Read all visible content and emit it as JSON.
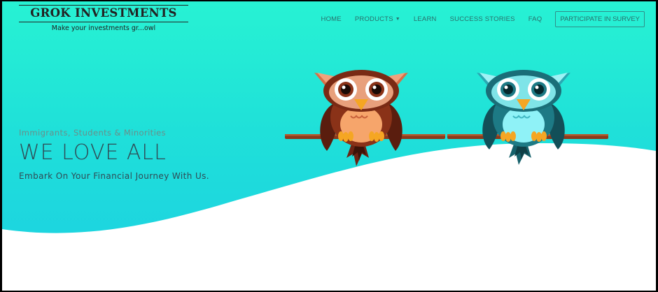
{
  "brand": {
    "name": "GROK INVESTMENTS",
    "tagline": "Make your investments gr...owl"
  },
  "nav": {
    "items": [
      {
        "label": "HOME"
      },
      {
        "label": "PRODUCTS",
        "has_dropdown": true
      },
      {
        "label": "LEARN"
      },
      {
        "label": "SUCCESS STORIES"
      },
      {
        "label": "FAQ"
      }
    ],
    "cta_label": "PARTICIPATE IN SURVEY",
    "caret_icon": "caret-down-icon"
  },
  "hero": {
    "subtitle": "Immigrants, Students & Minorities",
    "title": "WE LOVE ALL",
    "lead": "Embark On Your Financial Journey With Us."
  },
  "illustration": {
    "icons": [
      "brown-owl-icon",
      "teal-owl-icon",
      "branch-icon"
    ]
  },
  "colors": {
    "background_top": "#27f2d3",
    "background_bottom": "#1ccfe3",
    "wave": "#ffffff",
    "text_dark": "#2f4b55",
    "nav_text": "#2a6f6b",
    "owl_brown": "#7b2e1a",
    "owl_teal": "#1d7a85"
  }
}
